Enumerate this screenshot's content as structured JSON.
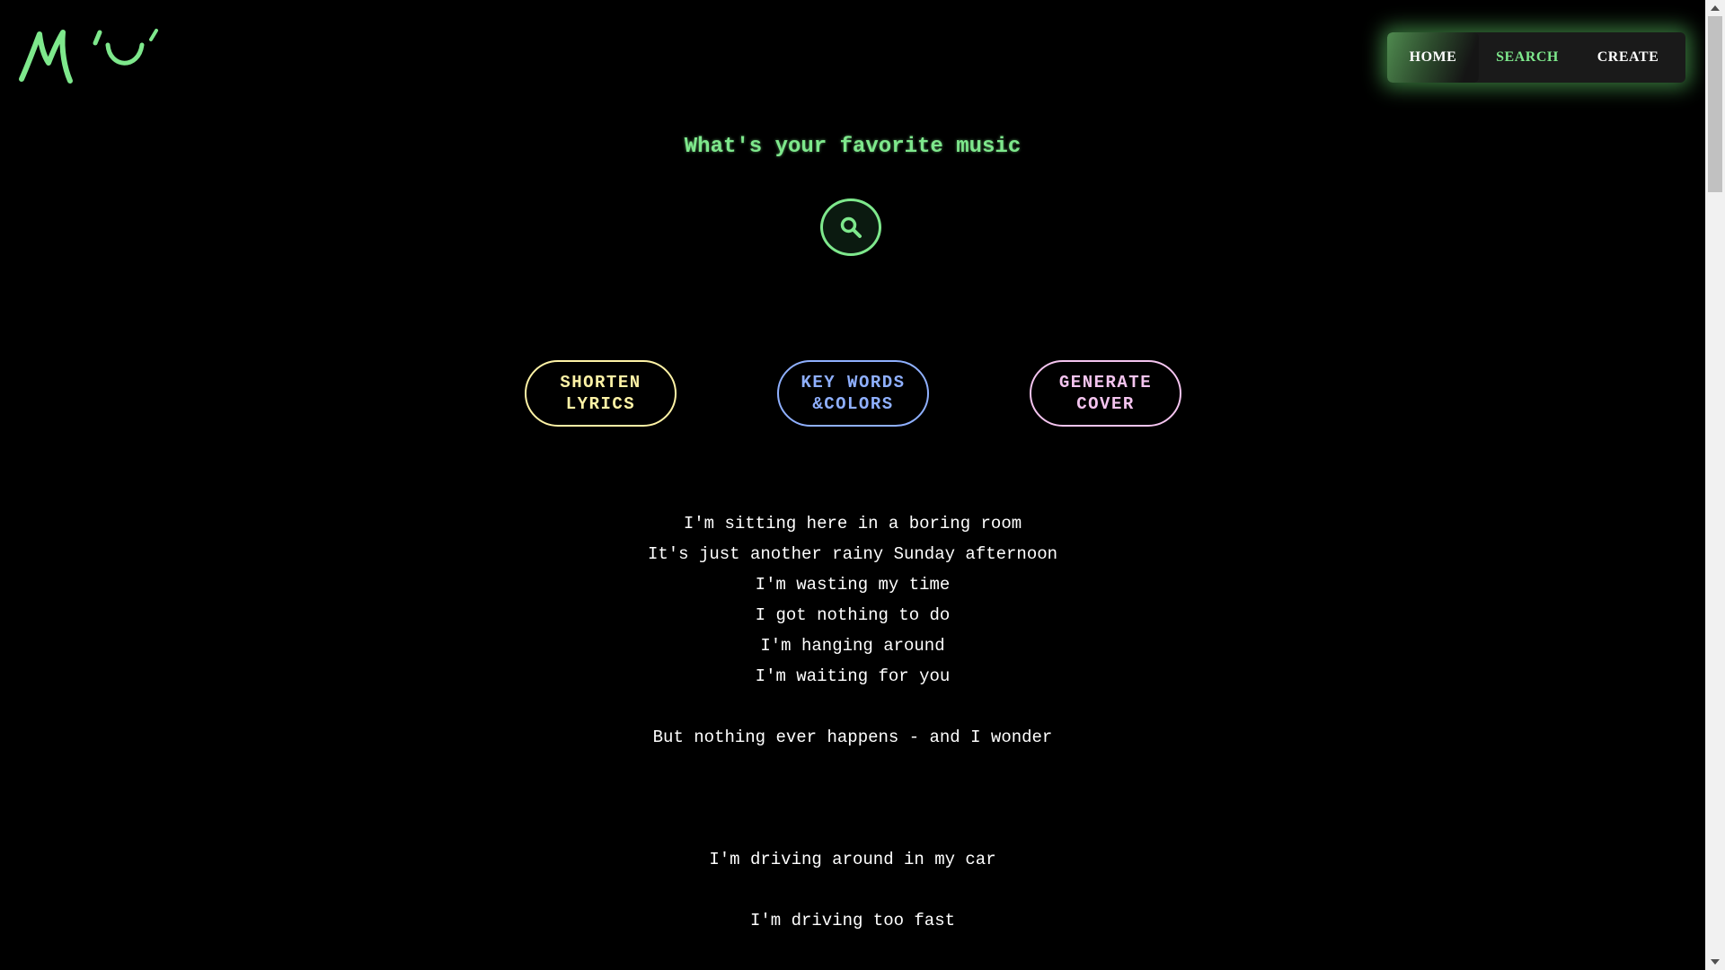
{
  "nav": {
    "items": [
      {
        "label": "HOME",
        "active": true
      },
      {
        "label": "SEARCH",
        "active": false
      },
      {
        "label": "CREATE",
        "active": false
      }
    ]
  },
  "main": {
    "title": "What's your favorite music",
    "search_icon": "search-icon",
    "actions": [
      {
        "label": "SHORTEN\nLYRICS",
        "color": "#fff3a6"
      },
      {
        "label": "KEY WORDS\n&COLORS",
        "color": "#8fb0ff"
      },
      {
        "label": "GENERATE\nCOVER",
        "color": "#f4c4ef"
      }
    ],
    "lyrics": [
      "I'm sitting here in a boring room",
      "It's just another rainy Sunday afternoon",
      "I'm wasting my time",
      "I got nothing to do",
      "I'm hanging around",
      "I'm waiting for you",
      "",
      "But nothing ever happens - and I wonder",
      "",
      "",
      "",
      "I'm driving around in my car",
      "",
      "I'm driving too fast"
    ]
  },
  "colors": {
    "accent": "#7ee88c",
    "background": "#000000"
  }
}
